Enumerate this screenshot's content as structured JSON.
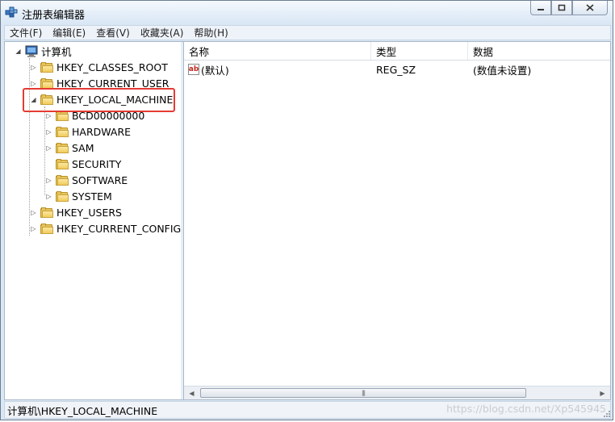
{
  "window": {
    "title": "注册表编辑器"
  },
  "menu": [
    "文件(F)",
    "编辑(E)",
    "查看(V)",
    "收藏夹(A)",
    "帮助(H)"
  ],
  "tree": {
    "root": "计算机",
    "hives": [
      {
        "label": "HKEY_CLASSES_ROOT"
      },
      {
        "label": "HKEY_CURRENT_USER"
      },
      {
        "label": "HKEY_LOCAL_MACHINE",
        "children": [
          "BCD00000000",
          "HARDWARE",
          "SAM",
          "SECURITY",
          "SOFTWARE",
          "SYSTEM"
        ]
      },
      {
        "label": "HKEY_USERS"
      },
      {
        "label": "HKEY_CURRENT_CONFIG"
      }
    ]
  },
  "list": {
    "columns": [
      "名称",
      "类型",
      "数据"
    ],
    "rows": [
      {
        "name": "(默认)",
        "type": "REG_SZ",
        "data": "(数值未设置)"
      }
    ]
  },
  "status": {
    "path": "计算机\\HKEY_LOCAL_MACHINE"
  },
  "watermark": "https://blog.csdn.net/Xp545945",
  "colors": {
    "highlight_box": "#e43b33",
    "folder": "#f2cc5c"
  }
}
